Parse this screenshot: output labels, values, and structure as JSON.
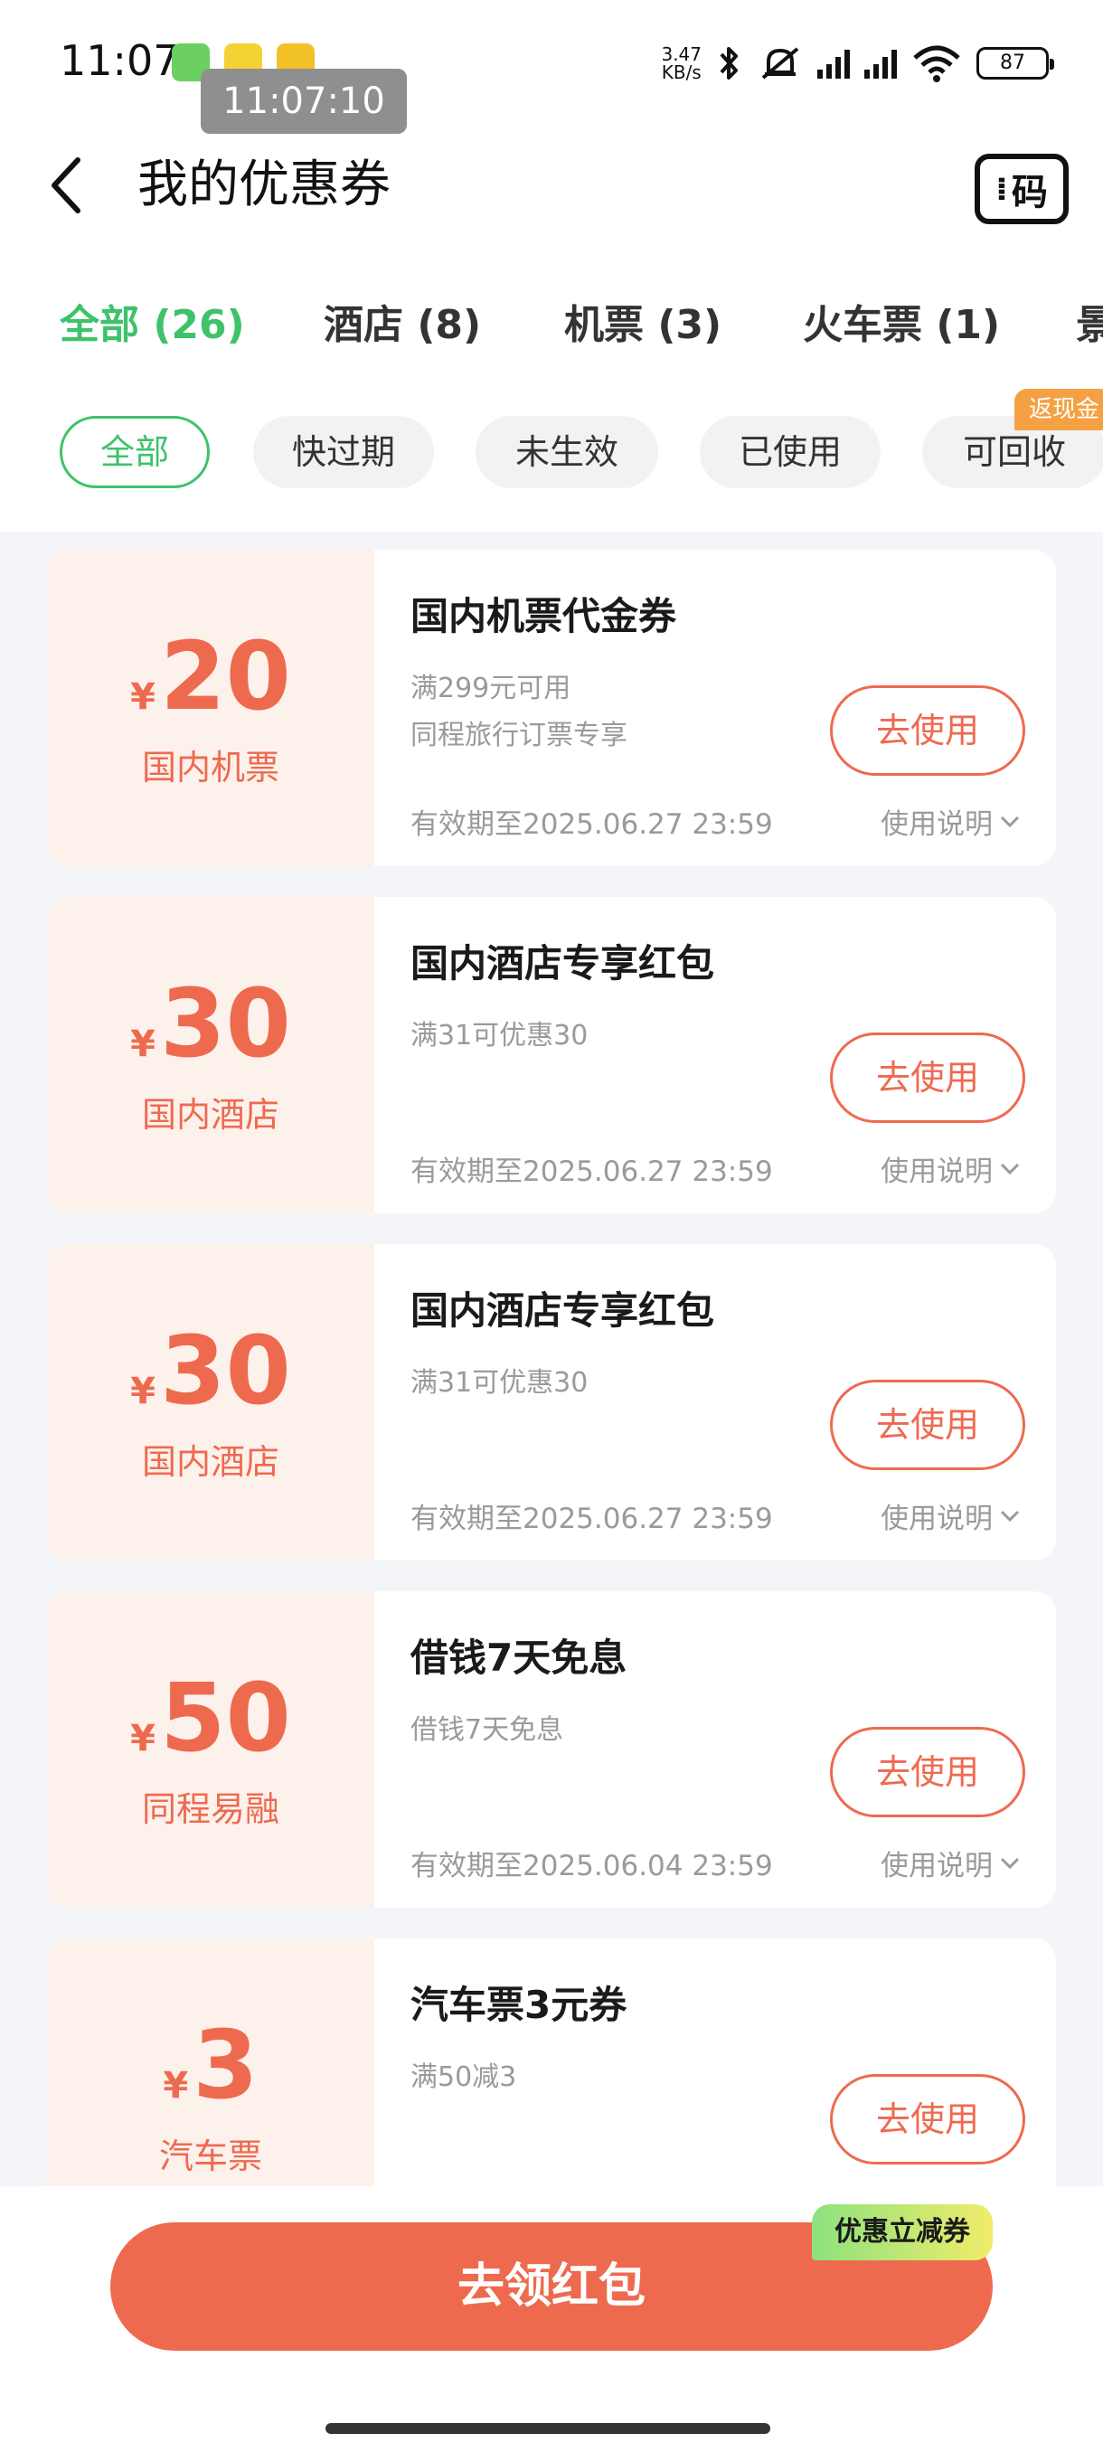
{
  "status_bar": {
    "time": "11:07",
    "clock_overlay": "11:07:10",
    "net_speed_value": "3.47",
    "net_speed_unit": "KB/s",
    "battery": "87",
    "icons": [
      "bluetooth-icon",
      "mute-icon",
      "signal-icon",
      "wifi-icon",
      "battery-icon"
    ]
  },
  "nav": {
    "title": "我的优惠券",
    "code_button": "码"
  },
  "tabs": [
    {
      "label": "全部 (26)",
      "active": true
    },
    {
      "label": "酒店 (8)",
      "active": false
    },
    {
      "label": "机票 (3)",
      "active": false
    },
    {
      "label": "火车票 (1)",
      "active": false
    },
    {
      "label": "景",
      "active": false
    }
  ],
  "filters": [
    {
      "label": "全部",
      "active": true
    },
    {
      "label": "快过期",
      "active": false
    },
    {
      "label": "未生效",
      "active": false
    },
    {
      "label": "已使用",
      "active": false
    },
    {
      "label": "可回收",
      "active": false
    }
  ],
  "filter_badge": "返现金",
  "coupons": [
    {
      "currency": "¥",
      "amount": "20",
      "category": "国内机票",
      "title": "国内机票代金券",
      "conditions": [
        "满299元可用",
        "同程旅行订票专享"
      ],
      "button": "去使用",
      "expiry": "有效期至2025.06.27 23:59",
      "howto": "使用说明"
    },
    {
      "currency": "¥",
      "amount": "30",
      "category": "国内酒店",
      "title": "国内酒店专享红包",
      "conditions": [
        "满31可优惠30"
      ],
      "button": "去使用",
      "expiry": "有效期至2025.06.27 23:59",
      "howto": "使用说明"
    },
    {
      "currency": "¥",
      "amount": "30",
      "category": "国内酒店",
      "title": "国内酒店专享红包",
      "conditions": [
        "满31可优惠30"
      ],
      "button": "去使用",
      "expiry": "有效期至2025.06.27 23:59",
      "howto": "使用说明"
    },
    {
      "currency": "¥",
      "amount": "50",
      "category": "同程易融",
      "title": "借钱7天免息",
      "conditions": [
        "借钱7天免息"
      ],
      "button": "去使用",
      "expiry": "有效期至2025.06.04 23:59",
      "howto": "使用说明"
    },
    {
      "currency": "¥",
      "amount": "3",
      "category": "汽车票",
      "title": "汽车票3元券",
      "conditions": [
        "满50减3"
      ],
      "button": "去使用",
      "expiry": "",
      "howto": ""
    }
  ],
  "bottom": {
    "claim_button": "去领红包",
    "promo_tag": "优惠立减券"
  },
  "colors": {
    "accent_green": "#3ec26a",
    "coupon_red": "#ee6a4f",
    "coupon_left_bg": "#fdf1ec",
    "badge_orange": "#f4a144"
  }
}
